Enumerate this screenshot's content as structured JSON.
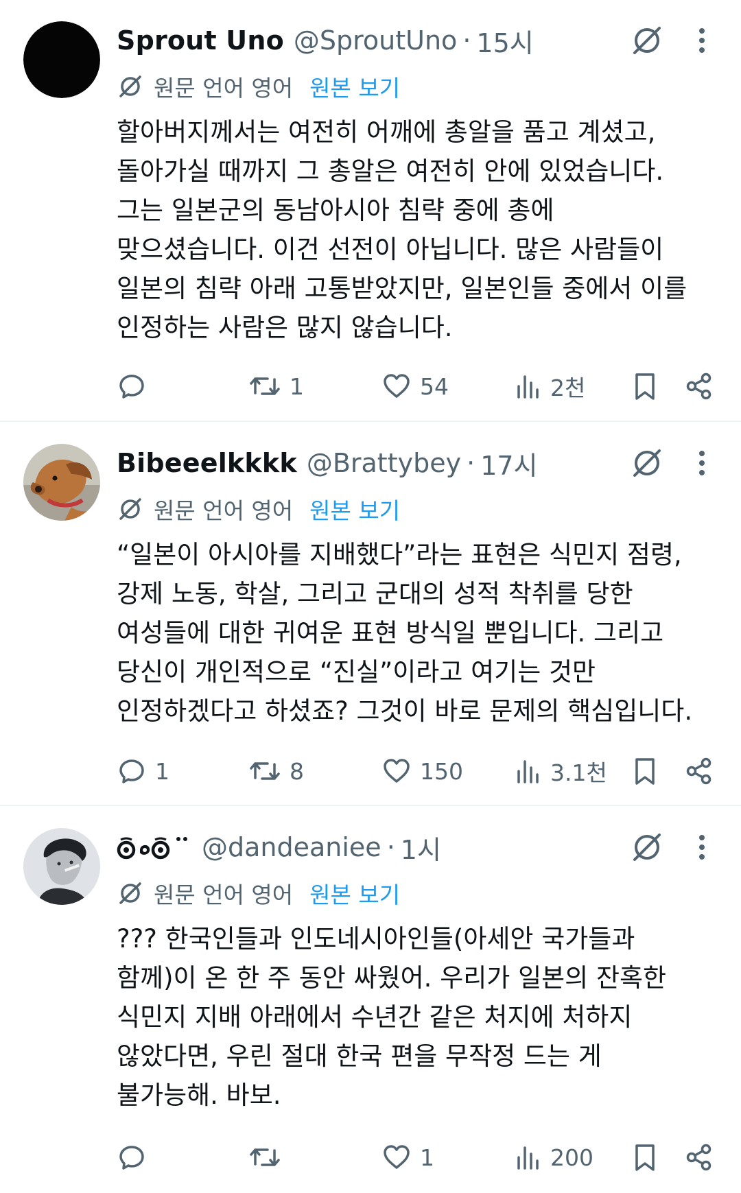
{
  "tweets": [
    {
      "display_name": "Sprout Uno",
      "handle": "@SproutUno",
      "separator": "·",
      "time": "15시",
      "translation_note": "원문 언어 영어",
      "show_original": "원본 보기",
      "lines": [
        "할아버지께서는 여전히 어깨에 총알을 품고 계셨고,",
        "돌아가실 때까지 그 총알은 여전히 안에 있었습니다.",
        "그는 일본군의 동남아시아 침략 중에 총에",
        "맞으셨습니다. 이건 선전이 아닙니다. 많은 사람들이",
        "일본의 침략 아래 고통받았지만, 일본인들 중에서 이를",
        "인정하는 사람은 많지 않습니다."
      ],
      "replies": "",
      "reposts": "1",
      "likes": "54",
      "views": "2천"
    },
    {
      "display_name": "Bibeeelkkkk",
      "handle": "@Brattybey",
      "separator": "·",
      "time": "17시",
      "translation_note": "원문 언어 영어",
      "show_original": "원본 보기",
      "lines": [
        "“일본이 아시아를 지배했다”라는 표현은 식민지 점령,",
        "강제 노동, 학살, 그리고 군대의 성적 착취를 당한",
        "여성들에 대한 귀여운 표현 방식일 뿐입니다. 그리고",
        "당신이 개인적으로 “진실”이라고 여기는 것만",
        "인정하겠다고 하셨죠? 그것이 바로 문제의 핵심입니다."
      ],
      "replies": "1",
      "reposts": "8",
      "likes": "150",
      "views": "3.1천"
    },
    {
      "display_name": "",
      "handle": "@dandeaniee",
      "separator": "·",
      "time": "1시",
      "translation_note": "원문 언어 영어",
      "show_original": "원본 보기",
      "lines": [
        "??? 한국인들과 인도네시아인들(아세안 국가들과",
        "함께)이 온 한 주 동안 싸웠어. 우리가 일본의 잔혹한",
        "식민지 지배 아래에서 수년간 같은 처지에 처하지",
        "않았다면, 우린 절대 한국 편을 무작정 드는 게",
        "불가능해. 바보."
      ],
      "replies": "",
      "reposts": "",
      "likes": "1",
      "views": "200"
    }
  ],
  "icons": {
    "reply": "reply-icon",
    "repost": "repost-icon",
    "like": "heart-icon",
    "views": "views-icon",
    "bookmark": "bookmark-icon",
    "share": "share-icon",
    "grok": "grok-icon",
    "more": "more-icon",
    "translate": "translate-icon"
  },
  "colors": {
    "text": "#0f1419",
    "secondary": "#536471",
    "link": "#1d9bf0",
    "divider": "#eff3f4"
  }
}
